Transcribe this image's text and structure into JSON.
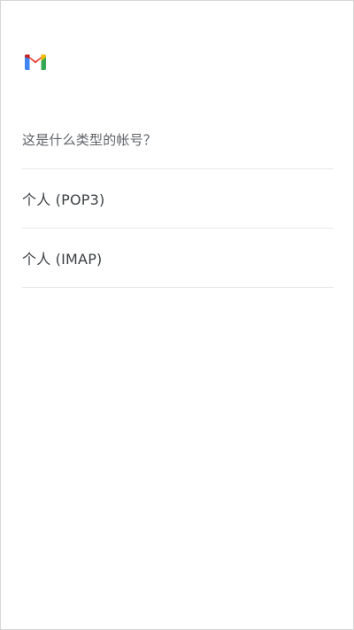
{
  "app": {
    "logo_icon": "gmail-logo-icon"
  },
  "setup": {
    "prompt": "这是什么类型的帐号？",
    "options": [
      {
        "label": "个人 (POP3)"
      },
      {
        "label": "个人 (IMAP)"
      }
    ]
  },
  "colors": {
    "gmail_blue": "#4285F4",
    "gmail_red": "#EA4335",
    "gmail_yellow": "#FBBC04",
    "gmail_green": "#34A853",
    "text_primary": "#3c4043",
    "text_secondary": "#5f6368",
    "divider": "#e8e8e8"
  }
}
